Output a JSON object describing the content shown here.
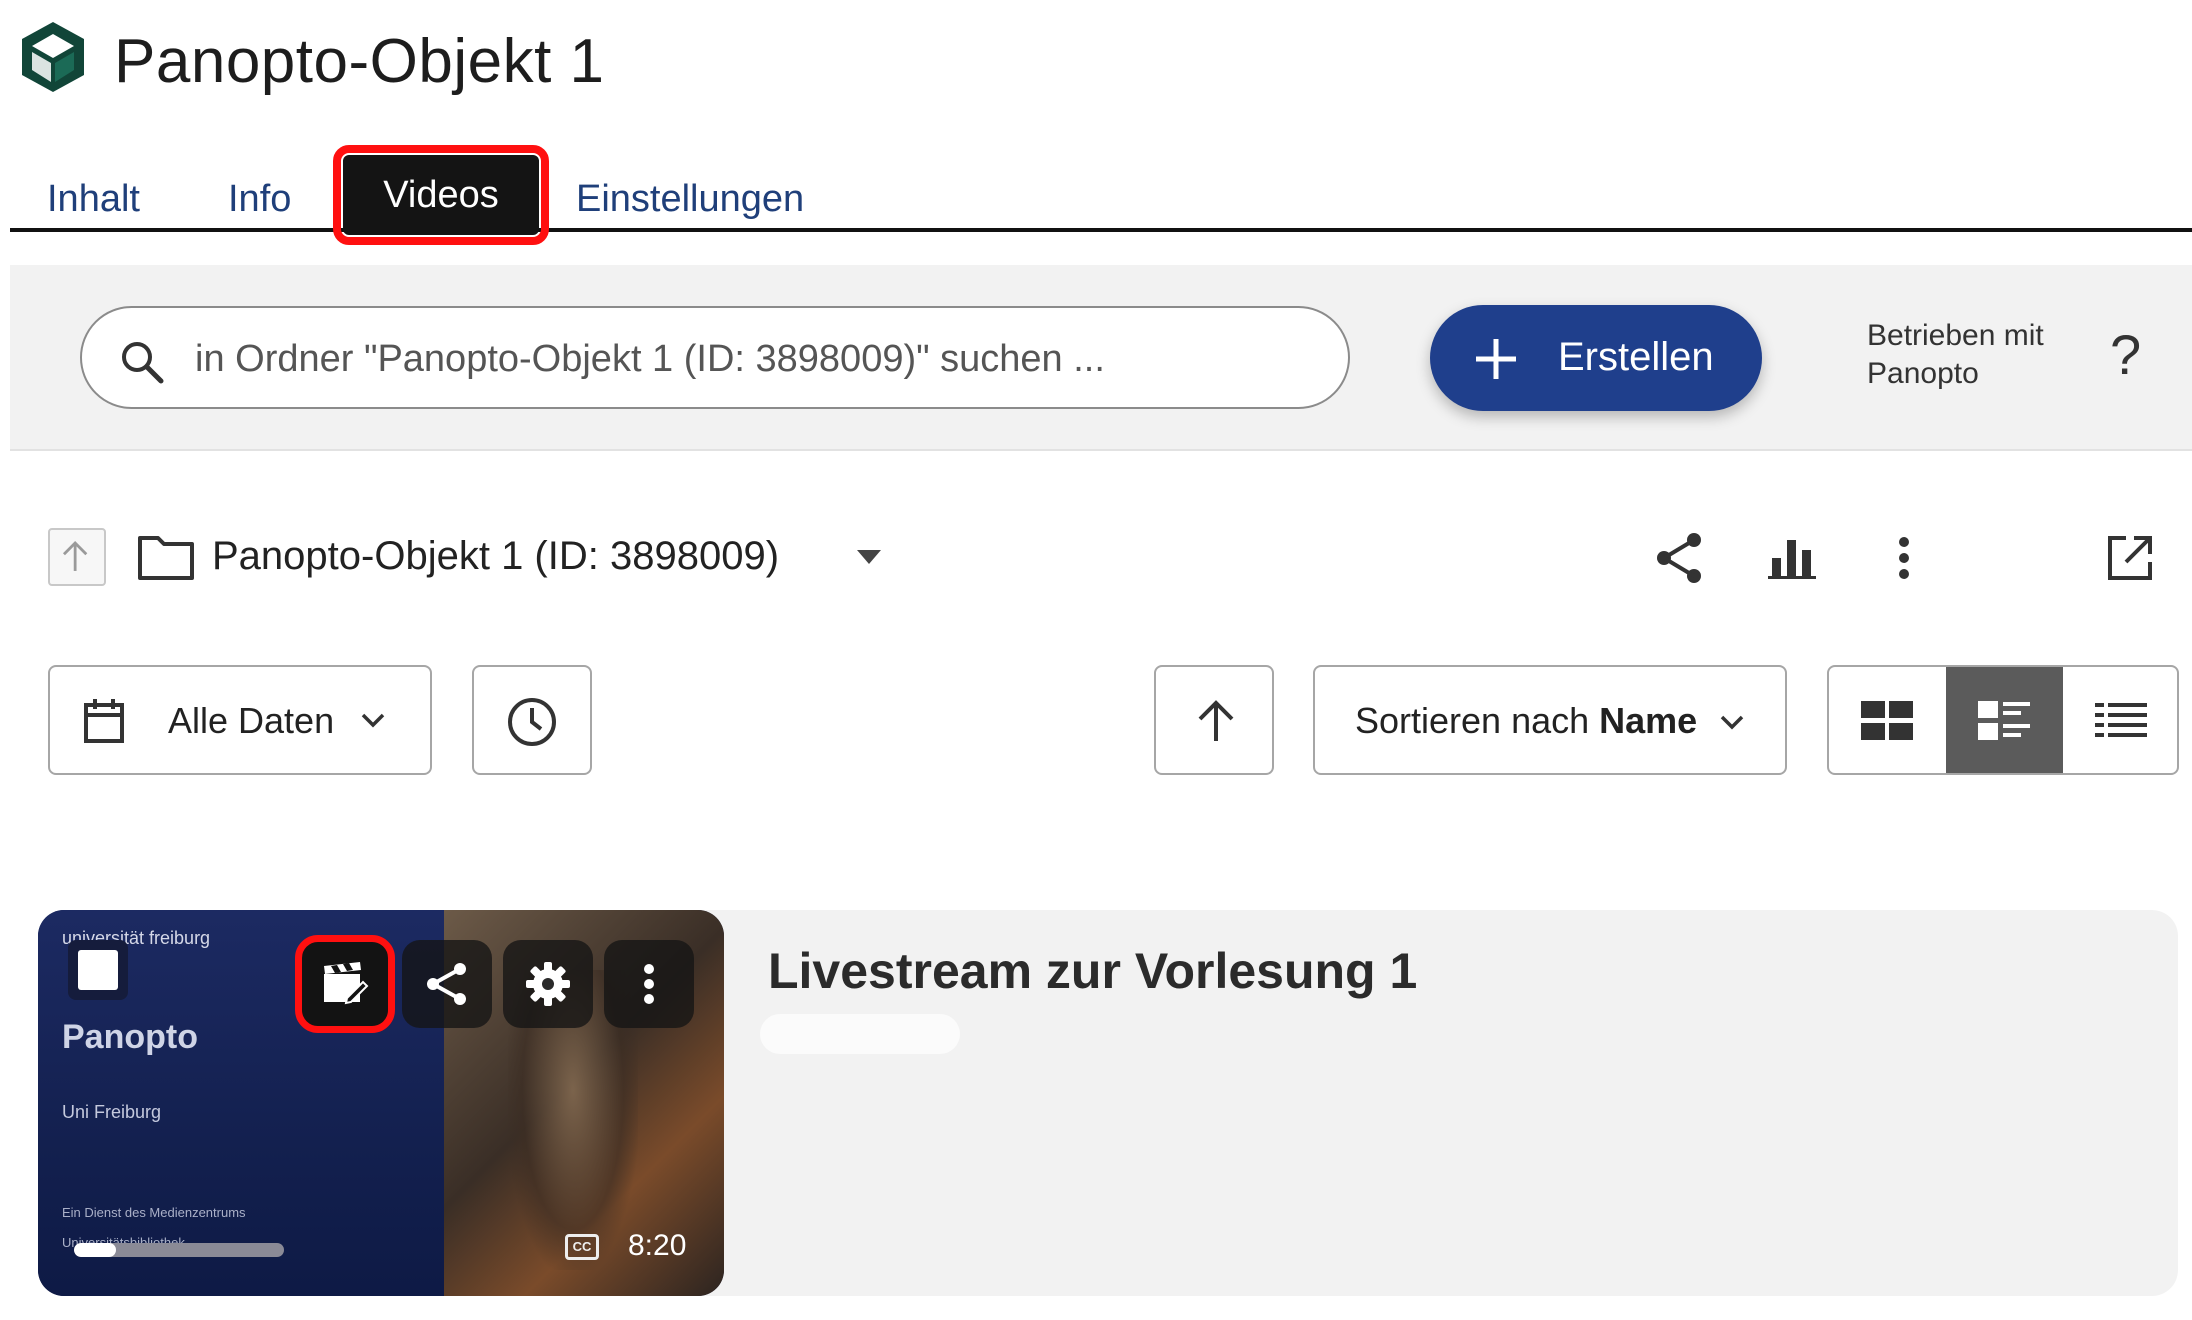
{
  "header": {
    "title": "Panopto-Objekt 1"
  },
  "tabs": [
    {
      "label": "Inhalt",
      "active": false
    },
    {
      "label": "Info",
      "active": false
    },
    {
      "label": "Videos",
      "active": true
    },
    {
      "label": "Einstellungen",
      "active": false
    }
  ],
  "toolbar": {
    "search_placeholder": "in Ordner \"Panopto-Objekt 1 (ID: 3898009)\" suchen ...",
    "create_label": "Erstellen",
    "powered_by": "Betrieben mit Panopto",
    "help_label": "?"
  },
  "folder": {
    "name": "Panopto-Objekt 1 (ID: 3898009)",
    "actions": [
      "share-icon",
      "stats-icon",
      "more-vert-icon",
      "open-external-icon"
    ]
  },
  "filters": {
    "date_label": "Alle Daten",
    "sort_prefix": "Sortieren nach ",
    "sort_field": "Name",
    "view_modes": [
      "grid-view-icon",
      "detail-view-icon",
      "list-view-icon"
    ],
    "selected_view": "detail-view-icon"
  },
  "video": {
    "title": "Livestream zur Vorlesung 1",
    "duration": "8:20",
    "cc": "CC",
    "progress": 0.2,
    "thumb_brand": "universität freiburg",
    "thumb_product": "Panopto",
    "thumb_sub": "Uni Freiburg",
    "thumb_service": "Ein Dienst des Medienzentrums",
    "thumb_library": "Universitätsbibliothek",
    "overlay_actions": [
      "edit-video-icon",
      "share-icon",
      "settings-icon",
      "more-vert-icon"
    ]
  },
  "colors": {
    "accent": "#1f3f8c",
    "tab_text": "#1f3f7a",
    "highlight": "#ff1010",
    "toolbar_bg": "#f2f2f2"
  }
}
